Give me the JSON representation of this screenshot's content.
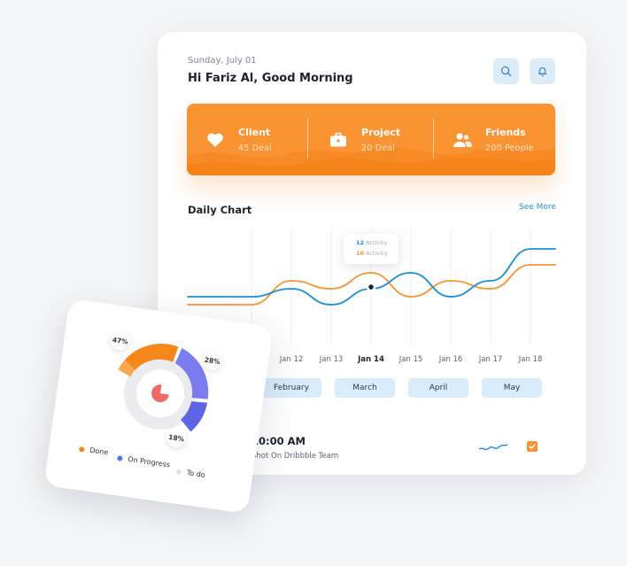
{
  "header": {
    "date": "Sunday, July 01",
    "greeting": "Hi Fariz Al, Good Morning",
    "search_icon": "search-icon",
    "bell_icon": "bell-icon"
  },
  "stats": [
    {
      "label": "Client",
      "value": "45 Deal",
      "icon": "heart-icon"
    },
    {
      "label": "Project",
      "value": "20 Deal",
      "icon": "briefcase-icon"
    },
    {
      "label": "Friends",
      "value": "200 People",
      "icon": "users-icon"
    }
  ],
  "chart": {
    "title": "Daily Chart",
    "see_more": "See More",
    "tooltip": {
      "blue_value": "12",
      "blue_label": "Activity",
      "orange_value": "10",
      "orange_label": "Activity"
    },
    "colors": {
      "orange": "#fa9332",
      "blue": "#1a8fd6"
    }
  },
  "chart_data": {
    "type": "line",
    "x": [
      "",
      "Jan 12",
      "Jan 13",
      "Jan 14",
      "Jan 15",
      "Jan 16",
      "Jan 17",
      "Jan 18"
    ],
    "active_label": "Jan 14",
    "series": [
      {
        "values": [
          8,
          11,
          10,
          12,
          9,
          11,
          10,
          13
        ]
      },
      {
        "values": [
          9,
          10,
          8,
          10,
          12,
          9,
          11,
          15
        ]
      }
    ]
  },
  "months": [
    "February",
    "March",
    "April",
    "May"
  ],
  "task": {
    "time": "10:00 AM",
    "title": "Shot On Dribbble Team"
  },
  "donut": {
    "segments": [
      {
        "label": "Done",
        "percent": "47%",
        "color": "#f7861b"
      },
      {
        "label": "On Progress",
        "percent": "28%",
        "color": "#7b7cf0"
      },
      {
        "label": "To do",
        "percent": "18%",
        "color": "#e3e4e8"
      }
    ]
  }
}
